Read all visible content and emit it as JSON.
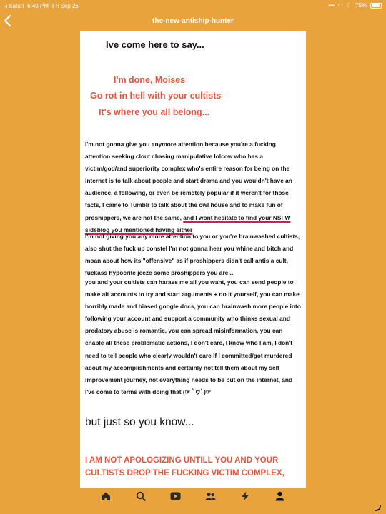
{
  "status": {
    "back_app": "◂ Safari",
    "time": "6:40 PM",
    "date": "Fri Sep 26",
    "battery": "75%"
  },
  "nav": {
    "title": "the-new-antiship-hunter"
  },
  "post": {
    "heading": "Ive come here to say...",
    "red_lines": [
      "I'm done, Moises",
      "Go rot in hell with your cultists",
      "It's where you all belong..."
    ],
    "para1_before": "I'm not gonna give you anymore attention because you're a fucking attention seeking clout chasing manipulative lolcow who has a victim/god/and superiority complex who's entire reason for being on the internet is to talk about people and start drama and you wouldn't have an audience, a following, or even be remotely popular if it weren't for those facts, I came to Tumblr to talk about the owl house and to make fun of proshippers, we are not the same, ",
    "para1_underlined": "and I wont hesitate to find your NSFW sideblog you mentioned having either",
    "para2": "I'm not giving you any more attention to you or you're brainwashed cultists, also shut the fuck up constel I'm not gonna hear you whine and bitch and moan about how its \"offensive\" as if proshippers didn't call antis a cult, fuckass hypocrite jeeze some proshippers you are...",
    "para3": "you and your cultists can harass me all you want, you can send people to make alt accounts to try and start arguments + do it yourself, you can make horribly made and biased google docs, you can brainwash more people into following your account and support a community who thinks sexual and predatory abuse is romantic, you can spread misinformation, you can enable all these problematic actions, I don't care, I know who I am, I don't need to tell people who clearly wouldn't care if I committed/got murdered about my accomplishments and certainly not tell them about my self improvement journey, not everything needs to be put on the internet, and I've come to terms with doing that (☞ ﾟヮﾟ)☞",
    "big_line": "but just so you know...",
    "red_block": "I AM NOT APOLOGIZING UNTILL YOU AND YOUR CULTISTS DROP THE FUCKING VICTIM COMPLEX,"
  },
  "tabs": [
    "home-icon",
    "search-icon",
    "video-icon",
    "community-icon",
    "activity-icon",
    "account-icon"
  ],
  "colors": {
    "background": "#E8A33D",
    "red_text": "#E8553B",
    "underline": "#D8175A"
  }
}
